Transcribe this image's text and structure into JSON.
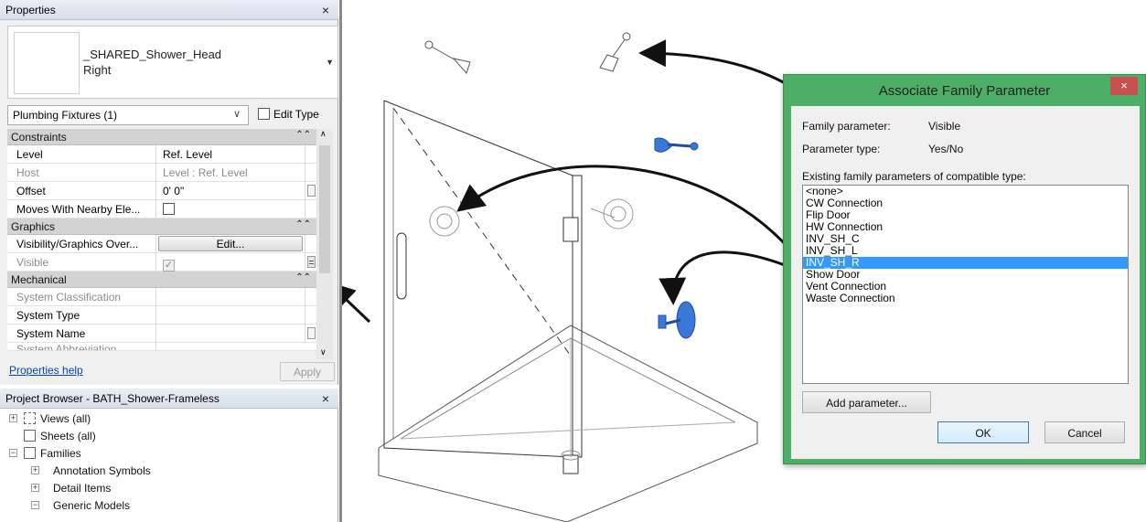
{
  "properties": {
    "title": "Properties",
    "close": "×",
    "type_name_line1": "_SHARED_Shower_Head",
    "type_name_line2": "Right",
    "category": "Plumbing Fixtures (1)",
    "edit_type": "Edit Type",
    "sections": {
      "constraints": "Constraints",
      "graphics": "Graphics",
      "mechanical": "Mechanical"
    },
    "rows": {
      "level_k": "Level",
      "level_v": "Ref. Level",
      "host_k": "Host",
      "host_v": "Level : Ref. Level",
      "offset_k": "Offset",
      "offset_v": "0'  0\"",
      "moves_k": "Moves With Nearby Ele...",
      "vgo_k": "Visibility/Graphics Over...",
      "vgo_v": "Edit...",
      "visible_k": "Visible",
      "sysclass_k": "System Classification",
      "systype_k": "System Type",
      "sysname_k": "System Name",
      "sysabbr_k": "System Abbreviation"
    },
    "help": "Properties help",
    "apply": "Apply"
  },
  "browser": {
    "title": "Project Browser - BATH_Shower-Frameless",
    "close": "×",
    "items": [
      {
        "label": "Views (all)"
      },
      {
        "label": "Sheets (all)"
      },
      {
        "label": "Families"
      },
      {
        "label": "Annotation Symbols"
      },
      {
        "label": "Detail Items"
      },
      {
        "label": "Generic Models"
      }
    ]
  },
  "dialog": {
    "title": "Associate Family Parameter",
    "close": "×",
    "family_param_label": "Family parameter:",
    "family_param_value": "Visible",
    "param_type_label": "Parameter type:",
    "param_type_value": "Yes/No",
    "existing_label": "Existing family parameters of compatible type:",
    "options": [
      "<none>",
      "CW Connection",
      "Flip Door",
      "HW Connection",
      "INV_SH_C",
      "INV_SH_L",
      "INV_SH_R",
      "Show Door",
      "Vent Connection",
      "Waste Connection"
    ],
    "selected_option": "INV_SH_R",
    "add_parameter": "Add parameter...",
    "ok": "OK",
    "cancel": "Cancel"
  },
  "colors": {
    "dialog_frame": "#4cae67",
    "selection": "#3399ff",
    "highlight_blue": "#3a78d8"
  }
}
